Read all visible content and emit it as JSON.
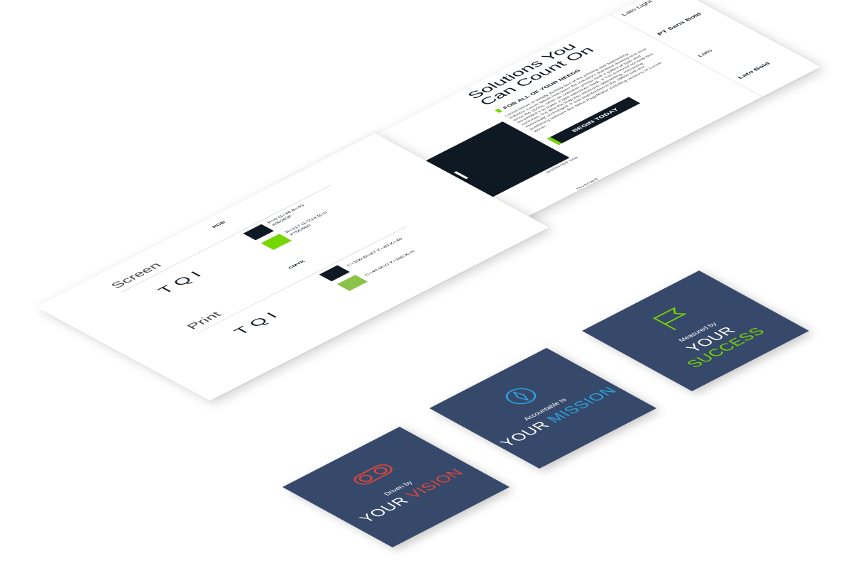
{
  "brand": {
    "logo_text": "TQI",
    "colors": {
      "navy": "#0f1923",
      "green": "#75d600",
      "slate": "#37496a",
      "red": "#e0473b",
      "blue": "#2aa3e0"
    }
  },
  "top_sheet": {
    "dark_logo_label": "preferred use",
    "light_logo_label": "reversed",
    "headline": "Solutions You Can Count On",
    "subhead": "FOR ALL OF YOUR NEEDS",
    "body": "Lorem Ipsum is simply dummy text of the printing and typesetting industry. Lorem Ipsum has been the industry's standard dummy text ever since the 1500s, when an unknown printer took a galley of type and scrambled it to make a type specimen book. It has survived not only five centuries, but also the leap into electronic typesetting, remaining essentially unchanged. It was popularised in the 1960s with the publishing software like Aldus PageMaker including versions of Lorem Ipsum.",
    "cta": "BEGIN TODAY",
    "fonts": [
      "Lato Light",
      "PT Sans Bold",
      "Lato",
      "Lato Bold"
    ]
  },
  "left_sheet": {
    "screen": {
      "title": "Screen",
      "mode": "RGB",
      "swatches": [
        {
          "color": "#0f1923",
          "text1": "R=0 G=38 B=43",
          "text2": "#00263F"
        },
        {
          "color": "#75d600",
          "text1": "R=117 G=214 B=0",
          "text2": "#75D600"
        }
      ]
    },
    "print": {
      "title": "Print",
      "mode": "CMYK",
      "swatches": [
        {
          "color": "#0f1923",
          "text1": "C=100 M=87 Y=40 K=40"
        },
        {
          "color": "#8bc34a",
          "text1": "C=40 M=0 Y=100 K=0"
        }
      ]
    }
  },
  "tiles": [
    {
      "icon": "binoculars-icon",
      "small": "Driven by",
      "w1": "YOUR",
      "w2": "VISION",
      "accent": "#e0473b"
    },
    {
      "icon": "compass-icon",
      "small": "Accountable to",
      "w1": "YOUR",
      "w2": "MISSION",
      "accent": "#2aa3e0"
    },
    {
      "icon": "flag-icon",
      "small": "Measured by",
      "w1": "YOUR",
      "w2": "SUCCESS",
      "accent": "#75d600"
    }
  ]
}
